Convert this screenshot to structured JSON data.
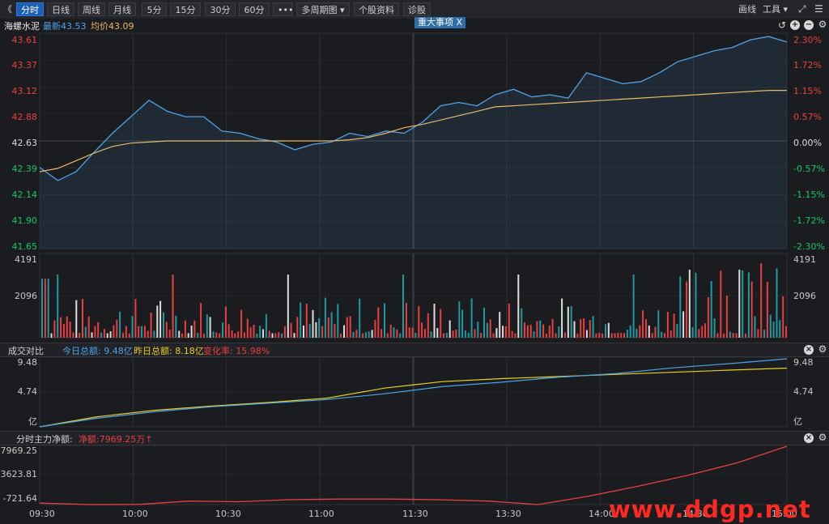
{
  "toolbar": {
    "items": [
      "分时",
      "日线",
      "周线",
      "月线",
      "5分",
      "15分",
      "30分",
      "60分",
      "•••",
      "多周期图 ▾",
      "个股资料",
      "诊股"
    ],
    "back": "《",
    "draw": "画线",
    "tools": "工具 ▾"
  },
  "info": {
    "name": "海螺水泥",
    "latest": "最新43.53",
    "avg": "均价43.09",
    "event_tag": "重大事项",
    "event_close": "X"
  },
  "price_axis": {
    "left": [
      "43.61",
      "43.37",
      "43.12",
      "42.88",
      "42.63",
      "42.39",
      "42.14",
      "41.90",
      "41.65"
    ],
    "right": [
      "2.30%",
      "1.72%",
      "1.15%",
      "0.57%",
      "0.00%",
      "-0.57%",
      "-1.15%",
      "-1.72%",
      "-2.30%"
    ]
  },
  "volume_axis": {
    "left": [
      "4191",
      "2096"
    ],
    "right": [
      "4191",
      "2096"
    ]
  },
  "turnover": {
    "title": "成交对比",
    "today": "今日总额: 9.48亿",
    "yesterday": "昨日总额: 8.18亿",
    "change": "变化率: 15.98%",
    "axis_left": [
      "9.48",
      "4.74",
      "亿"
    ],
    "axis_right": [
      "9.48",
      "4.74",
      "亿"
    ]
  },
  "capital": {
    "title": "分时主力净额:",
    "net": "净额:7969.25万↑",
    "axis": [
      "7969.25",
      "3623.81",
      "-721.64"
    ]
  },
  "time_axis": [
    "09:30",
    "10:00",
    "10:30",
    "11:00",
    "11:30",
    "13:30",
    "14:00",
    "14:30",
    "15:00"
  ],
  "watermark": "www.ddgp.net",
  "colors": {
    "up": "#e84040",
    "down": "#19c36c",
    "price": "#4da3e8",
    "avg": "#e8b86a",
    "yesterday": "#e8d020",
    "bg": "#1b1c20",
    "grid": "#2e3036"
  },
  "chart_data": [
    {
      "type": "line",
      "title": "",
      "series": [
        {
          "name": "最新",
          "values": [
            42.39,
            42.27,
            42.35,
            42.53,
            42.7,
            42.85,
            43.0,
            42.9,
            42.85,
            42.85,
            42.72,
            42.7,
            42.65,
            42.62,
            42.55,
            42.6,
            42.62,
            42.7,
            42.67,
            42.72,
            42.7,
            42.8,
            42.95,
            42.98,
            42.95,
            43.05,
            43.1,
            43.03,
            43.05,
            43.02,
            43.25,
            43.2,
            43.15,
            43.17,
            43.25,
            43.35,
            43.4,
            43.45,
            43.48,
            43.55,
            43.58,
            43.53
          ]
        },
        {
          "name": "均价",
          "values": [
            42.35,
            42.38,
            42.45,
            42.52,
            42.58,
            42.61,
            42.62,
            42.63,
            42.63,
            42.63,
            42.63,
            42.63,
            42.63,
            42.63,
            42.63,
            42.63,
            42.63,
            42.64,
            42.66,
            42.7,
            42.75,
            42.78,
            42.82,
            42.86,
            42.9,
            42.94,
            42.95,
            42.96,
            42.97,
            42.98,
            42.99,
            43.0,
            43.01,
            43.02,
            43.03,
            43.04,
            43.05,
            43.06,
            43.07,
            43.08,
            43.09,
            43.09
          ]
        }
      ],
      "ylim": [
        41.65,
        43.61
      ]
    },
    {
      "type": "bar",
      "title": "",
      "ylim": [
        0,
        4191
      ]
    },
    {
      "type": "line",
      "title": "",
      "series": [
        {
          "name": "今日总额",
          "values": [
            0,
            1.2,
            2.1,
            2.8,
            3.3,
            3.8,
            4.6,
            5.6,
            6.2,
            6.9,
            7.4,
            8.2,
            8.8,
            9.48
          ]
        },
        {
          "name": "昨日总额",
          "values": [
            0,
            1.4,
            2.3,
            2.9,
            3.4,
            4.0,
            5.4,
            6.3,
            6.7,
            7.0,
            7.3,
            7.6,
            7.9,
            8.18
          ]
        }
      ],
      "ylim": [
        0,
        9.48
      ]
    },
    {
      "type": "line",
      "title": "",
      "series": [
        {
          "name": "分时主力净额",
          "values": [
            -500,
            -721.64,
            -700,
            -200,
            -300,
            0,
            100,
            100,
            0,
            -200,
            -721.64,
            500,
            2000,
            3623.81,
            5500,
            7969.25
          ]
        }
      ],
      "ylim": [
        -721.64,
        7969.25
      ]
    }
  ]
}
